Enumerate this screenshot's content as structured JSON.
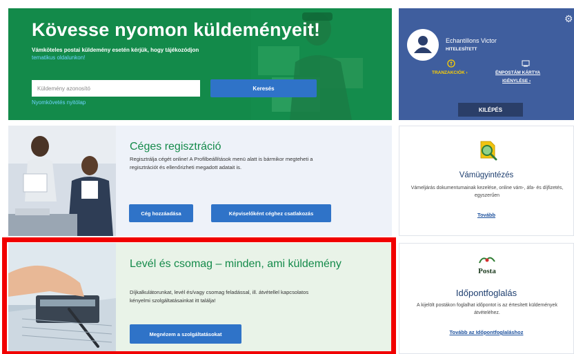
{
  "tracking": {
    "title": "Kövesse nyomon küldeményeit!",
    "subtitle": "Vámköteles postai küldemény esetén kérjük, hogy tájékozódjon",
    "subtitle_link": "tematikus oldalunkon!",
    "input_placeholder": "Küldemény azonosító",
    "search_label": "Keresés",
    "tracking_link": "Nyomkövetés nyitólap"
  },
  "user": {
    "name": "Echantillons Victor",
    "status": "HITELESÍTETT",
    "transactions": "TRANZAKCIÓK ›",
    "card_line1": "ÉNPOSTÁM KÁRTYA",
    "card_line2": "IGÉNYLÉSE ›",
    "logout": "KILÉPÉS"
  },
  "registration": {
    "title": "Céges regisztráció",
    "text": "Regisztrálja cégét online! A Profilbeállítások menü alatt is bármikor megteheti a regisztrációt és ellenőrizheti megadott adatait is.",
    "add_company": "Cég hozzáadása",
    "join_company": "Képviselőként céghez csatlakozás"
  },
  "customs": {
    "title": "Vámügyintézés",
    "text": "Vámeljárás dokumentumainak kezelése, online vám-, áfa- és díjfizetés, egyszerűen",
    "more": "Tovább"
  },
  "letter": {
    "title": "Levél és csomag – minden, ami küldemény",
    "text": "Díjkalkulátorunkat, levél és/vagy csomag feladással, ill. átvétellel kapcsolatos kényelmi szolgáltatásainkat itt találja!",
    "button": "Megnézem a szolgáltatásokat"
  },
  "appointment": {
    "logo": "Posta",
    "title": "Időpontfoglalás",
    "text": "A kijelölt postákon foglalhat időpontot is az értesített küldemények átvételéhez.",
    "more": "Tovább az Időpontfoglaláshoz"
  },
  "colors": {
    "green": "#138a4a",
    "blue_card": "#3f5e9e",
    "button_blue": "#2f73c8",
    "highlight": "#f10000",
    "accent_yellow": "#ffd000"
  }
}
